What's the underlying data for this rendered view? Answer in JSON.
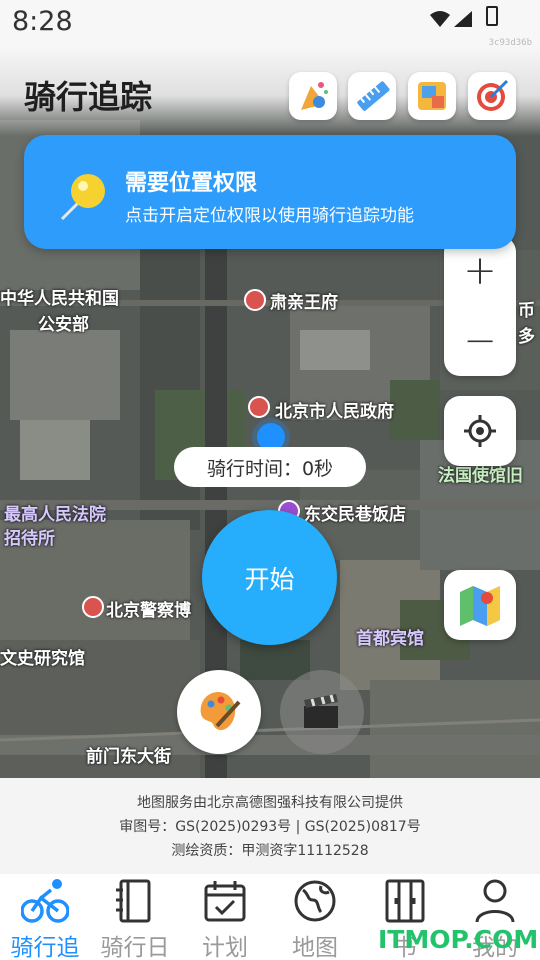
{
  "status_bar": {
    "time": "8:28",
    "build_id": "3c93d36b"
  },
  "header": {
    "title": "骑行追踪"
  },
  "banner": {
    "title": "需要位置权限",
    "description": "点击开启定位权限以使用骑行追踪功能"
  },
  "map": {
    "labels": {
      "suqinwang": "肃亲王府",
      "zhonghua_1": "中华人民共和国",
      "zhonghua_2": "公安部",
      "beijing_gov": "北京市人民政府",
      "supreme_court_1": "最高人民法院",
      "supreme_court_2": "招待所",
      "jiaomin": "东交民巷饭店",
      "police_museum": "北京警察博",
      "capital_hotel": "首都宾馆",
      "wenshi": "文史研究馆",
      "qianmen": "前门东大街",
      "french_embassy": "法国使馆旧",
      "right_edge_1": "币",
      "right_edge_2": "多"
    },
    "zoom_in_label": "+",
    "zoom_out_label": "−"
  },
  "ride": {
    "time_text": "骑行时间：0秒",
    "start_label": "开始"
  },
  "attribution": {
    "line1": "地图服务由北京高德图强科技有限公司提供",
    "line2": "审图号：GS(2025)0293号 | GS(2025)0817号",
    "line3": "测绘资质：甲测资字11112528"
  },
  "nav": {
    "items": [
      {
        "label": "骑行追",
        "icon": "bike-icon",
        "active": true
      },
      {
        "label": "骑行日",
        "icon": "notebook-icon",
        "active": false
      },
      {
        "label": "计划",
        "icon": "calendar-check-icon",
        "active": false
      },
      {
        "label": "地图",
        "icon": "globe-icon",
        "active": false
      },
      {
        "label": "书",
        "icon": "wardrobe-icon",
        "active": false
      },
      {
        "label": "我的",
        "icon": "person-icon",
        "active": false
      }
    ]
  },
  "watermark": "ITMOP.COM",
  "colors": {
    "accent": "#2e9cfb",
    "start_button": "#26aefc",
    "nav_active": "#1e90ff",
    "nav_inactive": "#9a9a9a"
  }
}
